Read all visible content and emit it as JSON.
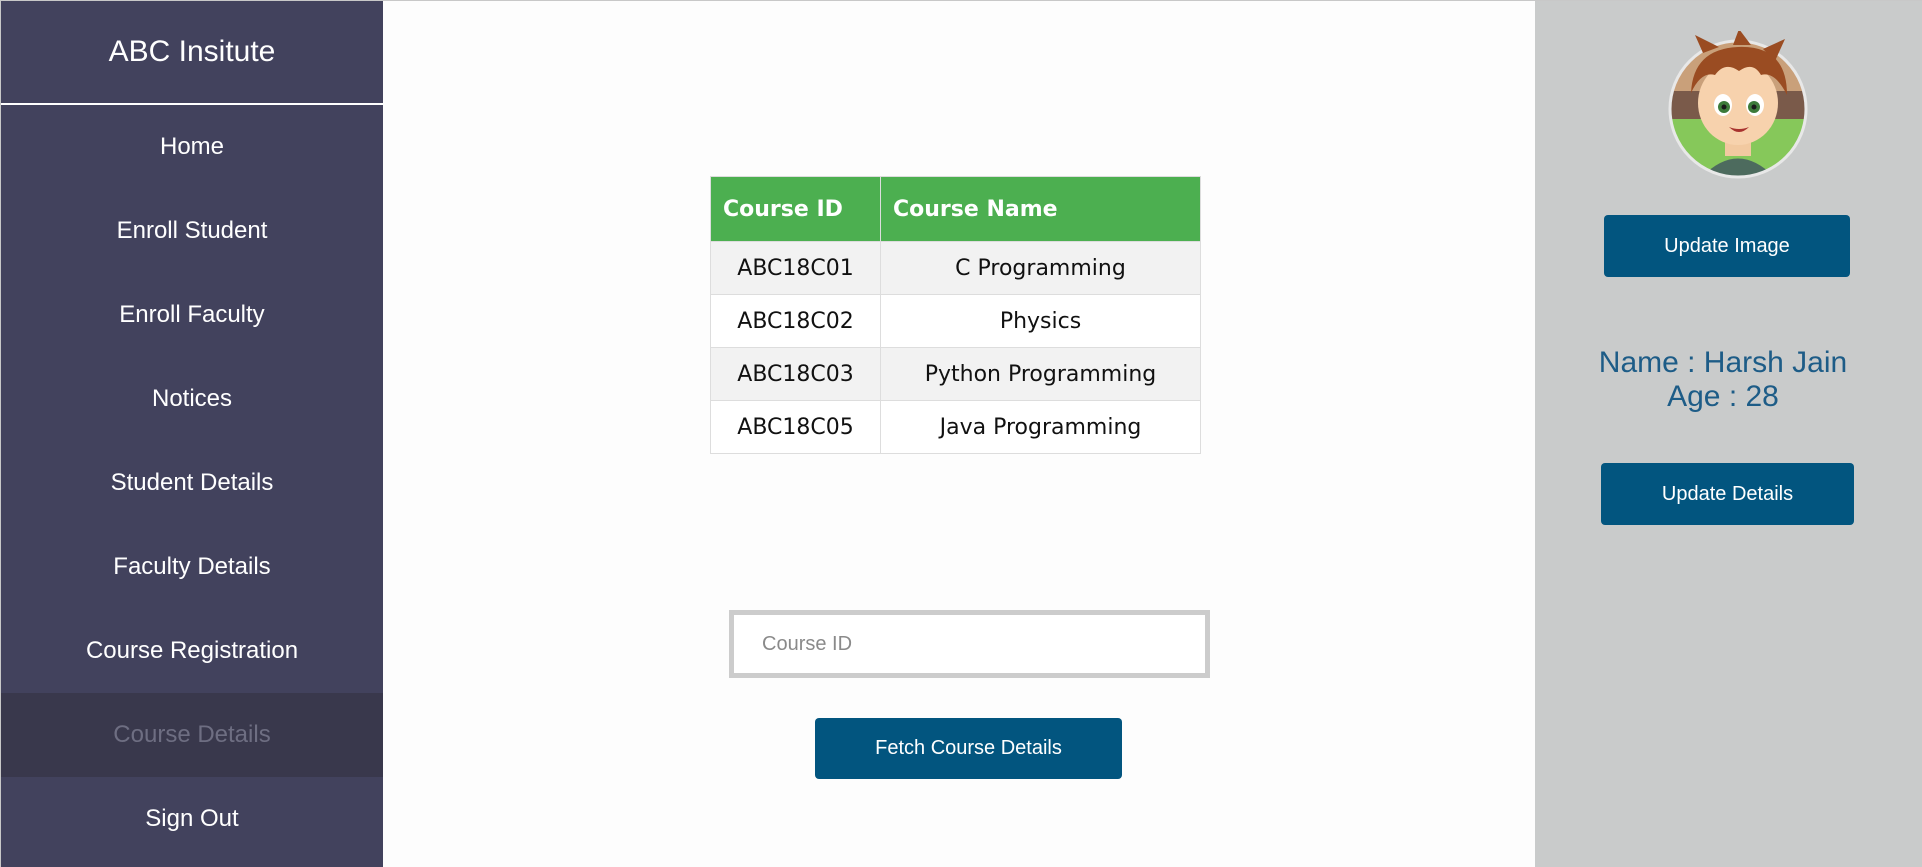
{
  "sidebar": {
    "brand": "ABC Insitute",
    "items": [
      {
        "label": "Home"
      },
      {
        "label": "Enroll Student"
      },
      {
        "label": "Enroll Faculty"
      },
      {
        "label": "Notices"
      },
      {
        "label": "Student Details"
      },
      {
        "label": "Faculty Details"
      },
      {
        "label": "Course Registration"
      },
      {
        "label": "Course Details"
      },
      {
        "label": "Sign Out"
      }
    ],
    "active_item": "Course Details"
  },
  "main": {
    "table": {
      "headers": [
        "Course ID",
        "Course Name"
      ],
      "rows": [
        [
          "ABC18C01",
          "C Programming"
        ],
        [
          "ABC18C02",
          "Physics"
        ],
        [
          "ABC18C03",
          "Python Programming"
        ],
        [
          "ABC18C05",
          "Java Programming"
        ]
      ]
    },
    "course_id_input": {
      "value": "",
      "placeholder": "Course ID"
    },
    "fetch_button": "Fetch Course Details"
  },
  "profile": {
    "avatar_icon": "cartoon-boy-avatar",
    "update_image_button": "Update Image",
    "name_line": "Name : Harsh Jain",
    "age_line": "Age : 28",
    "update_details_button": "Update Details"
  },
  "colors": {
    "sidebar_bg": "#42425d",
    "sidebar_active_bg": "#39384c",
    "table_header": "#4caf50",
    "button": "#02557f",
    "profile_panel": "#c9cbcb",
    "profile_text": "#1d5c87"
  }
}
